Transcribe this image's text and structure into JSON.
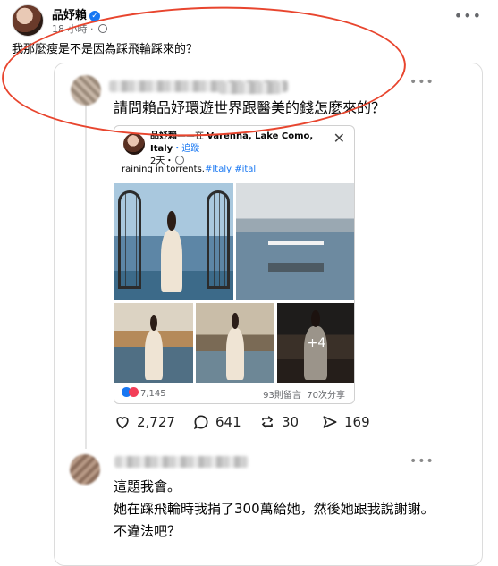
{
  "post": {
    "author": "品妤賴",
    "verified_mark": "✓",
    "time": "18 小時",
    "caption": "我那麼瘦是不是因為踩飛輪踩來的？",
    "more": "•••"
  },
  "thread": {
    "question": "請問賴品妤環遊世界跟醫美的錢怎麼來的？",
    "more": "•••",
    "embed": {
      "author": "品妤賴",
      "location_prefix": "——在 ",
      "location": "Varenna, Lake Como, Italy",
      "follow": "・追蹤",
      "meta": "2天・",
      "text": "raining in torrents.",
      "tags": "#Italy #ital",
      "close": "✕",
      "more_photos": "+4",
      "reactions_count": "7,145",
      "comments": "93則留言",
      "shares": "70次分享"
    },
    "actions": {
      "likes": "2,727",
      "comments": "641",
      "reposts": "30",
      "shares": "169"
    }
  },
  "reply": {
    "more": "•••",
    "line1": "這題我會。",
    "line2": "她在踩飛輪時我捐了300萬給她，然後她跟我說謝謝。",
    "line3": "不違法吧？"
  },
  "colors": {
    "annotation_circle": "#e8452e",
    "link_blue": "#1877f2",
    "muted": "#65676b"
  }
}
